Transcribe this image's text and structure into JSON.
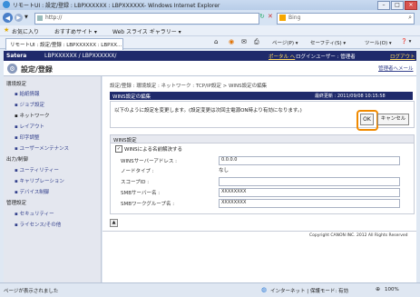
{
  "window": {
    "title": "リモートUI : 設定/登録 : LBPXXXXXX : LBPXXXXXX- Windows Internet Explorer"
  },
  "address": {
    "url": "http://",
    "search_placeholder": "Bing"
  },
  "favorites": {
    "label": "お気に入り",
    "link1": "おすすめサイト ▾",
    "link2": "Web スライス ギャラリー ▾"
  },
  "tab": {
    "label": "リモートUI : 設定/登録 : LBPXXXXXX : LBPXX..."
  },
  "cmdbar": {
    "page": "ページ(P) ▾",
    "safety": "セーフティ(S) ▾",
    "tools": "ツール(O) ▾",
    "help": "❓ ▾"
  },
  "header": {
    "brand": "Satera",
    "model": "LBPXXXXXX / LBPXXXXXX/",
    "portal": "ポータル へ",
    "login_user": "ログインユーザー : 管理者",
    "logout": "ログアウト",
    "page_title": "設定/登録",
    "admin_mail": "管理者へメール"
  },
  "sidebar": {
    "sections": [
      {
        "title": "環境設定",
        "items": [
          "給紙情報",
          "ジョブ設定",
          "ネットワーク",
          "レイアウト",
          "印字調整",
          "ユーザーメンテナンス"
        ]
      },
      {
        "title": "出力/制御",
        "items": [
          "ユーティリティー",
          "キャリブレーション",
          "デバイス制御"
        ]
      },
      {
        "title": "管理設定",
        "items": [
          "セキュリティー",
          "ライセンス/その他"
        ]
      }
    ]
  },
  "main": {
    "breadcrumb": "設定/登録 : 環境設定 : ネットワーク : TCP/IP設定 > WINS設定の編集",
    "panel_title": "WINS設定の編集",
    "last_updated": "最終更新 : 2011/09/08 10:15:58",
    "message": "以下のように設定を変更します。(設定変更は次回主電源ON時より有効になります。)",
    "ok_label": "OK",
    "cancel_label": "キャンセル",
    "section_title": "WINS設定",
    "checkbox_label": "WINSによる名前解決する",
    "fields": [
      {
        "label": "WINSサーバーアドレス :",
        "value": "0.0.0.0"
      },
      {
        "label": "ノードタイプ :",
        "value": "なし"
      },
      {
        "label": "スコープID :",
        "value": ""
      },
      {
        "label": "SMBサーバー名 :",
        "value": "XXXXXXXX"
      },
      {
        "label": "SMBワークグループ名 :",
        "value": "XXXXXXXX"
      }
    ],
    "copyright": "Copyright CANON INC. 2012 All Rights Reserved"
  },
  "status": {
    "left": "ページが表示されました",
    "zone": "インターネット | 保護モード: 有効",
    "zoom": "100%"
  },
  "colors": {
    "header": "#1f2a6b",
    "highlight": "#f08a00",
    "link": "#33408c"
  }
}
